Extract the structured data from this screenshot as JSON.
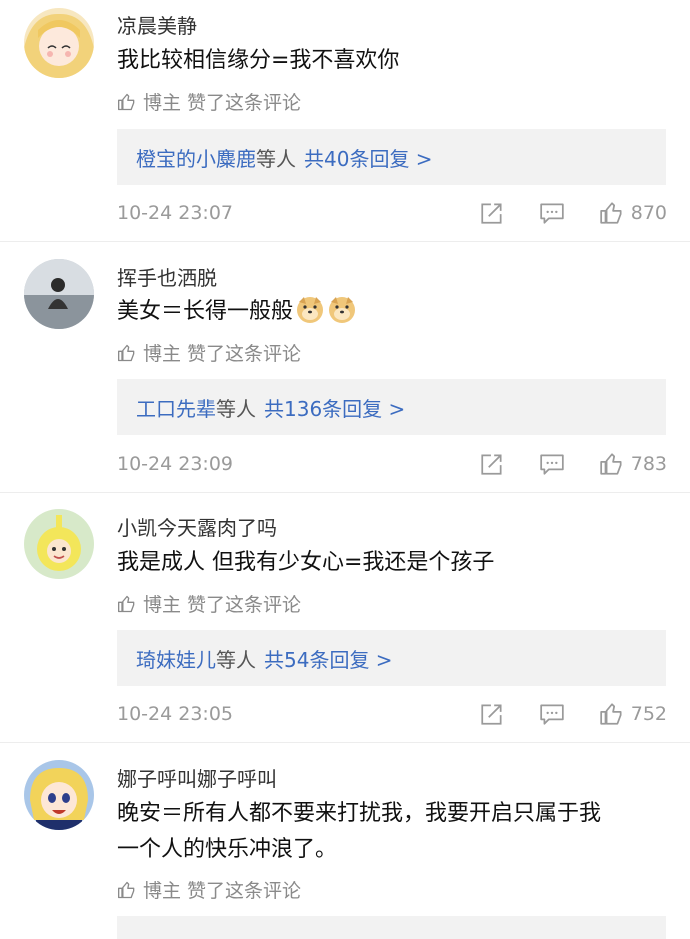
{
  "liked_label": "博主 赞了这条评论",
  "etc_label": "等人",
  "comments": [
    {
      "name": "凉晨美静",
      "text": [
        "我比较相信缘分=我不喜欢你"
      ],
      "reply_who": "橙宝的小麋鹿",
      "reply_count": "共40条回复 >",
      "time": "10-24 23:07",
      "likes": "870"
    },
    {
      "name": "挥手也洒脱",
      "text": [
        "美女＝长得一般般"
      ],
      "reply_who": "工口先辈",
      "reply_count": "共136条回复 >",
      "time": "10-24 23:09",
      "likes": "783"
    },
    {
      "name": "小凯今天露肉了吗",
      "text": [
        "我是成人 但我有少女心=我还是个孩子"
      ],
      "reply_who": "琦妹娃儿",
      "reply_count": "共54条回复 >",
      "time": "10-24 23:05",
      "likes": "752"
    },
    {
      "name": "娜子呼叫娜子呼叫",
      "text": [
        "晚安＝所有人都不要来打扰我，我要开启只属于我",
        "一个人的快乐冲浪了。"
      ]
    }
  ],
  "icons": {
    "like": "thumbs-up-icon",
    "repost": "share-icon",
    "comment": "comment-icon",
    "emoji": "doge-emoji-icon"
  }
}
